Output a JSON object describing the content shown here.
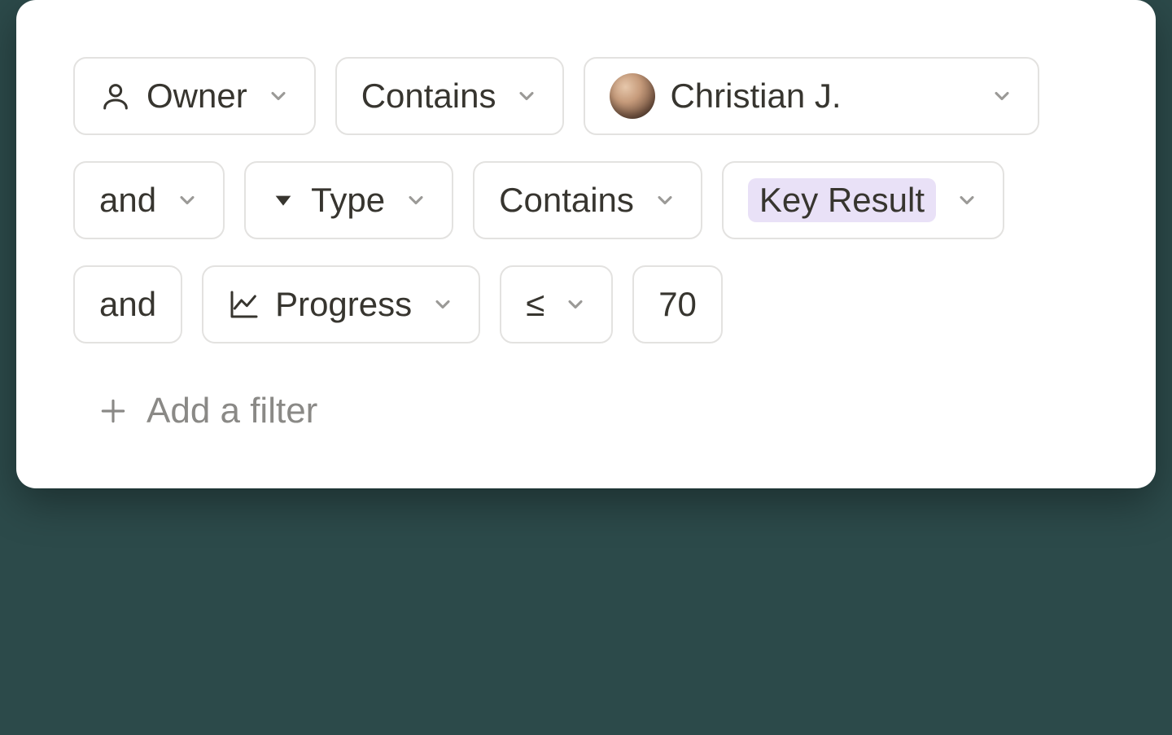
{
  "filters": {
    "row1": {
      "property": "Owner",
      "operator": "Contains",
      "value": "Christian J."
    },
    "row2": {
      "conjunction": "and",
      "property": "Type",
      "operator": "Contains",
      "value": "Key Result"
    },
    "row3": {
      "conjunction": "and",
      "property": "Progress",
      "operator": "≤",
      "value": "70"
    }
  },
  "add_filter_label": "Add a filter",
  "colors": {
    "tag_bg": "#e9e1f7"
  }
}
